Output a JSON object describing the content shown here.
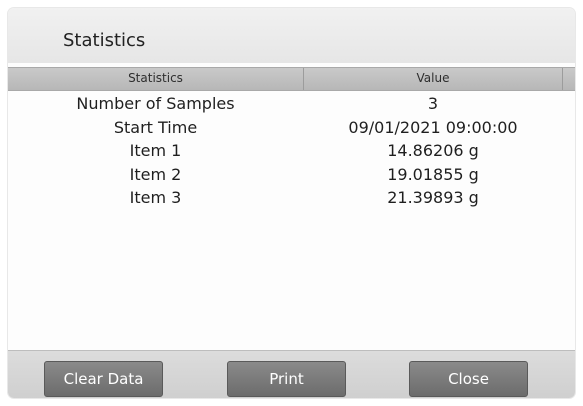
{
  "window": {
    "title": "Statistics"
  },
  "table": {
    "headers": {
      "statistics": "Statistics",
      "value": "Value"
    },
    "rows": [
      {
        "label": "Number of Samples",
        "value": "3"
      },
      {
        "label": "Start Time",
        "value": "09/01/2021 09:00:00"
      },
      {
        "label": "Item 1",
        "value": "14.86206 g"
      },
      {
        "label": "Item 2",
        "value": "19.01855 g"
      },
      {
        "label": "Item 3",
        "value": "21.39893 g"
      }
    ]
  },
  "buttons": {
    "clear_data": "Clear Data",
    "print": "Print",
    "close": "Close"
  }
}
